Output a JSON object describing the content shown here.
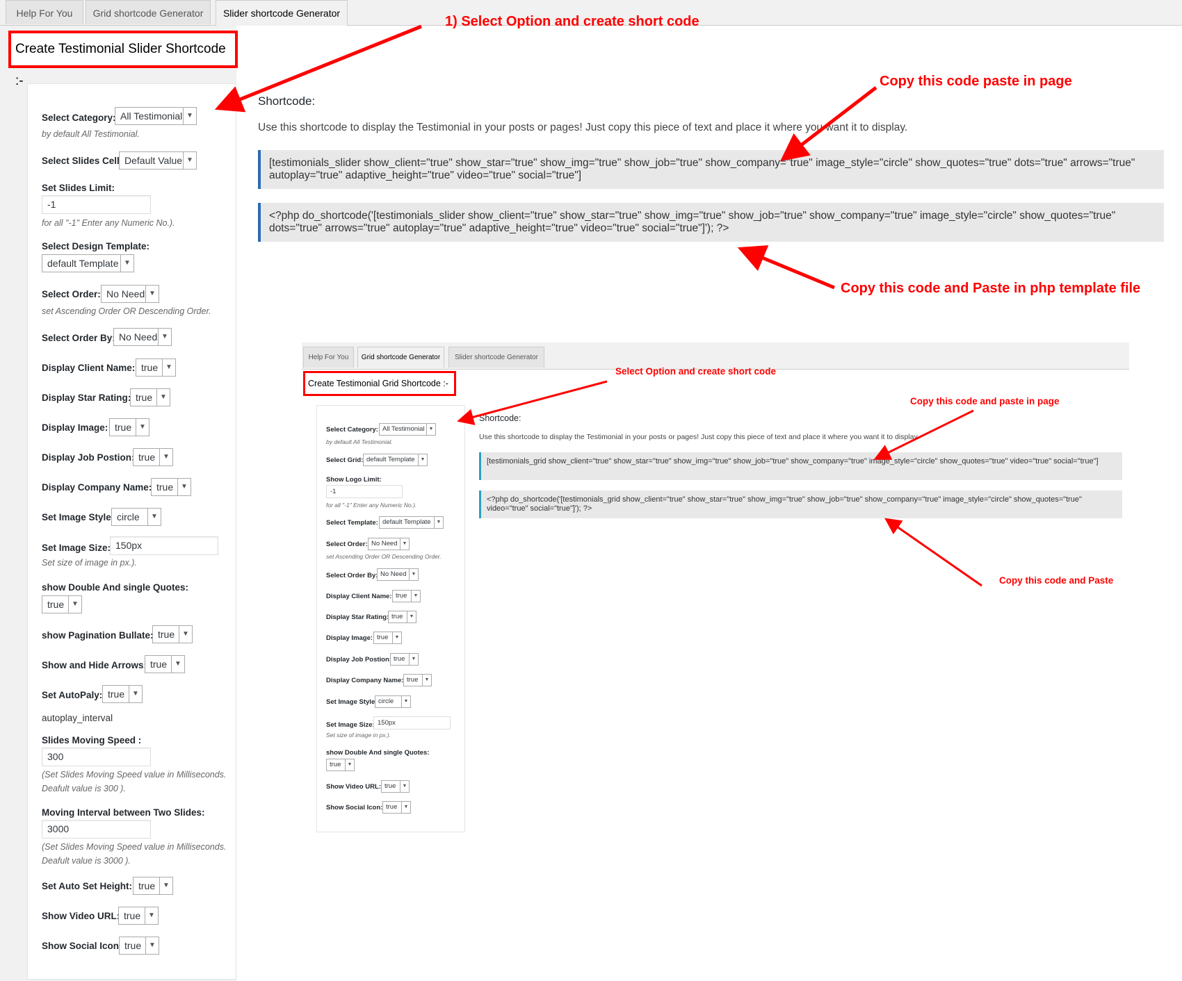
{
  "tabs": [
    "Help For You",
    "Grid shortcode Generator",
    "Slider shortcode Generator"
  ],
  "main_title": "Create Testimonial Slider Shortcode :-",
  "form": {
    "category_label": "Select Category:",
    "category_value": "All Testimonial",
    "category_hint": "by default All Testimonial.",
    "slides_cell_label": "Select Slides Cell:",
    "slides_cell_value": "Default Value",
    "slides_limit_label": "Set Slides Limit:",
    "slides_limit_value": "-1",
    "slides_limit_hint": "for all \"-1\" Enter any Numeric No.).",
    "design_template_label": "Select Design Template:",
    "design_template_value": "default Template",
    "order_label": "Select Order:",
    "order_value": "No Need",
    "order_hint": "set Ascending Order OR Descending Order.",
    "order_by_label": "Select Order By:",
    "order_by_value": "No Need",
    "client_name_label": "Display Client Name:",
    "client_name_value": "true",
    "star_rating_label": "Display Star Rating:",
    "star_rating_value": "true",
    "image_label": "Display Image:",
    "image_value": "true",
    "job_label": "Display Job Postion:",
    "job_value": "true",
    "company_label": "Display Company Name:",
    "company_value": "true",
    "image_style_label": "Set Image Style",
    "image_style_value": "circle",
    "image_size_label": "Set Image Size:",
    "image_size_value": "150px",
    "image_size_hint": "Set size of image in px.).",
    "quotes_label": "show Double And single Quotes:",
    "quotes_value": "true",
    "pagination_label": "show Pagination Bullate:",
    "pagination_value": "true",
    "arrows_label": "Show and Hide Arrows:",
    "arrows_value": "true",
    "autoplay_label": "Set AutoPaly:",
    "autoplay_value": "true",
    "autoplay_interval_text": "autoplay_interval",
    "speed_label": "Slides Moving Speed :",
    "speed_value": "300",
    "speed_hint_1": "(Set Slides Moving Speed value in Milliseconds.",
    "speed_hint_2": "Deafult value is 300 ).",
    "interval_label": "Moving Interval between Two Slides:",
    "interval_value": "3000",
    "interval_hint_1": "(Set Slides Moving Speed value in Milliseconds.",
    "interval_hint_2": "Deafult value is 3000 ).",
    "auto_height_label": "Set Auto Set Height:",
    "auto_height_value": "true",
    "video_label": "Show Video URL:",
    "video_value": "true",
    "social_label": "Show Social Icon:",
    "social_value": "true"
  },
  "shortcode": {
    "title": "Shortcode:",
    "description": "Use this shortcode to display the Testimonial in your posts or pages! Just copy this piece of text and place it where you want it to display.",
    "code1": "[testimonials_slider show_client=\"true\" show_star=\"true\" show_img=\"true\" show_job=\"true\" show_company=\"true\" image_style=\"circle\" show_quotes=\"true\" dots=\"true\" arrows=\"true\" autoplay=\"true\" adaptive_height=\"true\" video=\"true\" social=\"true\"]",
    "code2": "<?php do_shortcode('[testimonials_slider show_client=\"true\" show_star=\"true\" show_img=\"true\" show_job=\"true\" show_company=\"true\" image_style=\"circle\" show_quotes=\"true\" dots=\"true\" arrows=\"true\" autoplay=\"true\" adaptive_height=\"true\" video=\"true\" social=\"true\"]'); ?>"
  },
  "annotations": {
    "a1": "1) Select Option and create short code",
    "a2": "Copy this code paste in page",
    "a3": "Copy this code and Paste in php template file"
  },
  "inset": {
    "tabs": [
      "Help For You",
      "Grid shortcode Generator",
      "Slider shortcode Generator"
    ],
    "title": "Create Testimonial Grid Shortcode :-",
    "category_label": "Select Category:",
    "category_value": "All Testimonial",
    "category_hint": "by default All Testimonial.",
    "grid_label": "Select Grid:",
    "grid_value": "default Template",
    "logo_limit_label": "Show Logo Limit:",
    "logo_limit_value": "-1",
    "logo_limit_hint": "for all \"-1\" Enter any Numeric No.).",
    "template_label": "Select Template:",
    "template_value": "default Template",
    "order_label": "Select Order:",
    "order_value": "No Need",
    "order_hint": "set Ascending Order OR Descending Order.",
    "order_by_label": "Select Order By:",
    "order_by_value": "No Need",
    "client_name_label": "Display Client Name:",
    "client_name_value": "true",
    "star_rating_label": "Display Star Rating:",
    "star_rating_value": "true",
    "image_label": "Display Image:",
    "image_value": "true",
    "job_label": "Display Job Postion:",
    "job_value": "true",
    "company_label": "Display Company Name:",
    "company_value": "true",
    "image_style_label": "Set Image Style",
    "image_style_value": "circle",
    "image_size_label": "Set Image Size:",
    "image_size_value": "150px",
    "image_size_hint": "Set size of image in px.).",
    "quotes_label": "show Double And single Quotes:",
    "quotes_value": "true",
    "video_label": "Show Video URL:",
    "video_value": "true",
    "social_label": "Show Social Icon:",
    "social_value": "true",
    "sc_title": "Shortcode:",
    "sc_desc": "Use this shortcode to display the Testimonial in your posts or pages! Just copy this piece of text and place it where you want it to display.",
    "code1": "[testimonials_grid show_client=\"true\" show_star=\"true\" show_img=\"true\" show_job=\"true\" show_company=\"true\" image_style=\"circle\" show_quotes=\"true\" video=\"true\" social=\"true\"]",
    "code2": "<?php do_shortcode('[testimonials_grid show_client=\"true\" show_star=\"true\" show_img=\"true\" show_job=\"true\" show_company=\"true\" image_style=\"circle\" show_quotes=\"true\" video=\"true\" social=\"true\"]'); ?>",
    "a1": "Select Option and create short code",
    "a2": "Copy this code and paste in page",
    "a3": "Copy this code and Paste"
  },
  "colors": {
    "annotation": "#ff0000",
    "code_border": "#2b6cb0",
    "inset_code_border": "#2aa1c0"
  }
}
